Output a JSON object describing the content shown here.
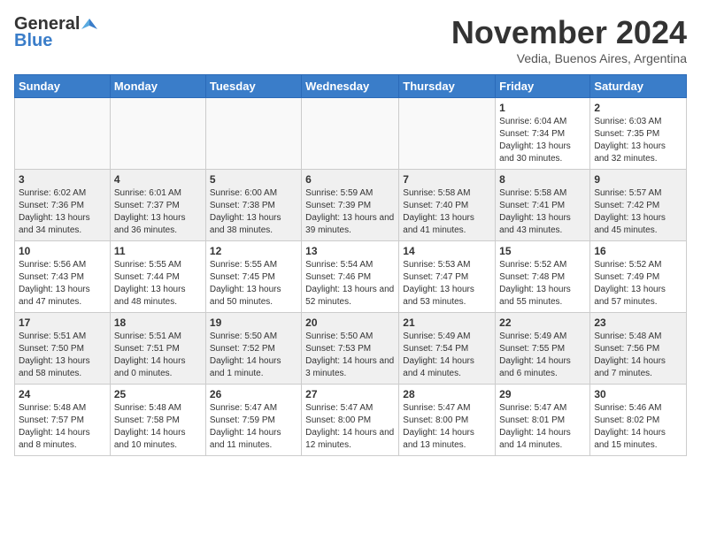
{
  "logo": {
    "general": "General",
    "blue": "Blue"
  },
  "title": "November 2024",
  "subtitle": "Vedia, Buenos Aires, Argentina",
  "days_header": [
    "Sunday",
    "Monday",
    "Tuesday",
    "Wednesday",
    "Thursday",
    "Friday",
    "Saturday"
  ],
  "weeks": [
    [
      {
        "day": "",
        "info": ""
      },
      {
        "day": "",
        "info": ""
      },
      {
        "day": "",
        "info": ""
      },
      {
        "day": "",
        "info": ""
      },
      {
        "day": "",
        "info": ""
      },
      {
        "day": "1",
        "info": "Sunrise: 6:04 AM\nSunset: 7:34 PM\nDaylight: 13 hours and 30 minutes."
      },
      {
        "day": "2",
        "info": "Sunrise: 6:03 AM\nSunset: 7:35 PM\nDaylight: 13 hours and 32 minutes."
      }
    ],
    [
      {
        "day": "3",
        "info": "Sunrise: 6:02 AM\nSunset: 7:36 PM\nDaylight: 13 hours and 34 minutes."
      },
      {
        "day": "4",
        "info": "Sunrise: 6:01 AM\nSunset: 7:37 PM\nDaylight: 13 hours and 36 minutes."
      },
      {
        "day": "5",
        "info": "Sunrise: 6:00 AM\nSunset: 7:38 PM\nDaylight: 13 hours and 38 minutes."
      },
      {
        "day": "6",
        "info": "Sunrise: 5:59 AM\nSunset: 7:39 PM\nDaylight: 13 hours and 39 minutes."
      },
      {
        "day": "7",
        "info": "Sunrise: 5:58 AM\nSunset: 7:40 PM\nDaylight: 13 hours and 41 minutes."
      },
      {
        "day": "8",
        "info": "Sunrise: 5:58 AM\nSunset: 7:41 PM\nDaylight: 13 hours and 43 minutes."
      },
      {
        "day": "9",
        "info": "Sunrise: 5:57 AM\nSunset: 7:42 PM\nDaylight: 13 hours and 45 minutes."
      }
    ],
    [
      {
        "day": "10",
        "info": "Sunrise: 5:56 AM\nSunset: 7:43 PM\nDaylight: 13 hours and 47 minutes."
      },
      {
        "day": "11",
        "info": "Sunrise: 5:55 AM\nSunset: 7:44 PM\nDaylight: 13 hours and 48 minutes."
      },
      {
        "day": "12",
        "info": "Sunrise: 5:55 AM\nSunset: 7:45 PM\nDaylight: 13 hours and 50 minutes."
      },
      {
        "day": "13",
        "info": "Sunrise: 5:54 AM\nSunset: 7:46 PM\nDaylight: 13 hours and 52 minutes."
      },
      {
        "day": "14",
        "info": "Sunrise: 5:53 AM\nSunset: 7:47 PM\nDaylight: 13 hours and 53 minutes."
      },
      {
        "day": "15",
        "info": "Sunrise: 5:52 AM\nSunset: 7:48 PM\nDaylight: 13 hours and 55 minutes."
      },
      {
        "day": "16",
        "info": "Sunrise: 5:52 AM\nSunset: 7:49 PM\nDaylight: 13 hours and 57 minutes."
      }
    ],
    [
      {
        "day": "17",
        "info": "Sunrise: 5:51 AM\nSunset: 7:50 PM\nDaylight: 13 hours and 58 minutes."
      },
      {
        "day": "18",
        "info": "Sunrise: 5:51 AM\nSunset: 7:51 PM\nDaylight: 14 hours and 0 minutes."
      },
      {
        "day": "19",
        "info": "Sunrise: 5:50 AM\nSunset: 7:52 PM\nDaylight: 14 hours and 1 minute."
      },
      {
        "day": "20",
        "info": "Sunrise: 5:50 AM\nSunset: 7:53 PM\nDaylight: 14 hours and 3 minutes."
      },
      {
        "day": "21",
        "info": "Sunrise: 5:49 AM\nSunset: 7:54 PM\nDaylight: 14 hours and 4 minutes."
      },
      {
        "day": "22",
        "info": "Sunrise: 5:49 AM\nSunset: 7:55 PM\nDaylight: 14 hours and 6 minutes."
      },
      {
        "day": "23",
        "info": "Sunrise: 5:48 AM\nSunset: 7:56 PM\nDaylight: 14 hours and 7 minutes."
      }
    ],
    [
      {
        "day": "24",
        "info": "Sunrise: 5:48 AM\nSunset: 7:57 PM\nDaylight: 14 hours and 8 minutes."
      },
      {
        "day": "25",
        "info": "Sunrise: 5:48 AM\nSunset: 7:58 PM\nDaylight: 14 hours and 10 minutes."
      },
      {
        "day": "26",
        "info": "Sunrise: 5:47 AM\nSunset: 7:59 PM\nDaylight: 14 hours and 11 minutes."
      },
      {
        "day": "27",
        "info": "Sunrise: 5:47 AM\nSunset: 8:00 PM\nDaylight: 14 hours and 12 minutes."
      },
      {
        "day": "28",
        "info": "Sunrise: 5:47 AM\nSunset: 8:00 PM\nDaylight: 14 hours and 13 minutes."
      },
      {
        "day": "29",
        "info": "Sunrise: 5:47 AM\nSunset: 8:01 PM\nDaylight: 14 hours and 14 minutes."
      },
      {
        "day": "30",
        "info": "Sunrise: 5:46 AM\nSunset: 8:02 PM\nDaylight: 14 hours and 15 minutes."
      }
    ]
  ]
}
